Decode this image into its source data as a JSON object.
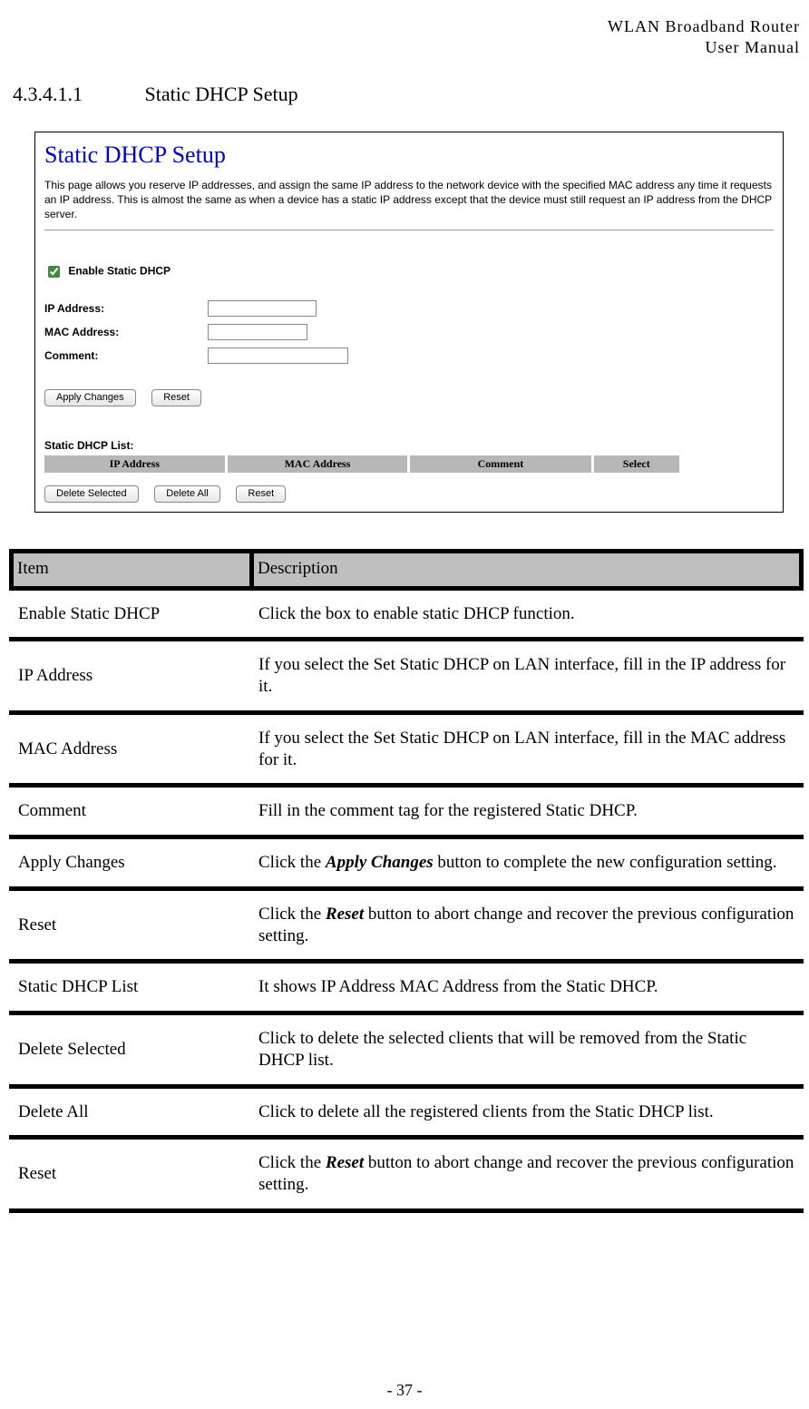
{
  "header": {
    "line1": "WLAN Broadband Router",
    "line2": "User Manual"
  },
  "section": {
    "number": "4.3.4.1.1",
    "title": "Static DHCP Setup"
  },
  "screenshot": {
    "title": "Static DHCP Setup",
    "description": "This page allows you reserve IP addresses, and assign the same IP address to the network device with the specified MAC address any time it requests an IP address. This is almost the same as when a device has a static IP address except that the device must still request an IP address from the DHCP server.",
    "enable_label": "Enable Static DHCP",
    "enable_checked": true,
    "fields": {
      "ip_label": "IP Address:",
      "mac_label": "MAC Address:",
      "comment_label": "Comment:",
      "ip_value": "",
      "mac_value": "",
      "comment_value": ""
    },
    "buttons": {
      "apply": "Apply Changes",
      "reset": "Reset"
    },
    "list_label": "Static DHCP List:",
    "list_headers": {
      "ip": "IP Address",
      "mac": "MAC Address",
      "comment": "Comment",
      "select": "Select"
    },
    "buttons2": {
      "delete_selected": "Delete Selected",
      "delete_all": "Delete All",
      "reset": "Reset"
    }
  },
  "table": {
    "header_item": "Item",
    "header_desc": "Description",
    "rows": [
      {
        "item": "Enable Static DHCP",
        "desc": "Click the box to enable static DHCP function."
      },
      {
        "item": "IP Address",
        "desc": "If you select the Set Static DHCP on LAN interface, fill in the IP address for it."
      },
      {
        "item": "MAC Address",
        "desc": "If you select the Set Static DHCP on LAN interface, fill in the MAC address for it."
      },
      {
        "item": "Comment",
        "desc": "Fill in the comment tag for the registered Static DHCP."
      },
      {
        "item": "Apply Changes",
        "desc_html": "Click the <span class='boldi'>Apply Changes</span> button to complete the new configuration setting."
      },
      {
        "item": "Reset",
        "desc_html": "Click the <span class='boldi'>Reset</span> button to abort change and recover the previous configuration setting."
      },
      {
        "item": "Static DHCP List",
        "desc": "It shows IP Address MAC Address from the Static DHCP."
      },
      {
        "item": "Delete Selected",
        "desc": "Click to delete the selected clients that will be removed from the Static DHCP list."
      },
      {
        "item": "Delete All",
        "desc": "Click to delete all the registered clients from the Static DHCP list."
      },
      {
        "item": "Reset",
        "desc_html": "Click the <span class='boldi'>Reset</span> button to abort change and recover the previous configuration setting."
      }
    ]
  },
  "footer": "- 37 -"
}
